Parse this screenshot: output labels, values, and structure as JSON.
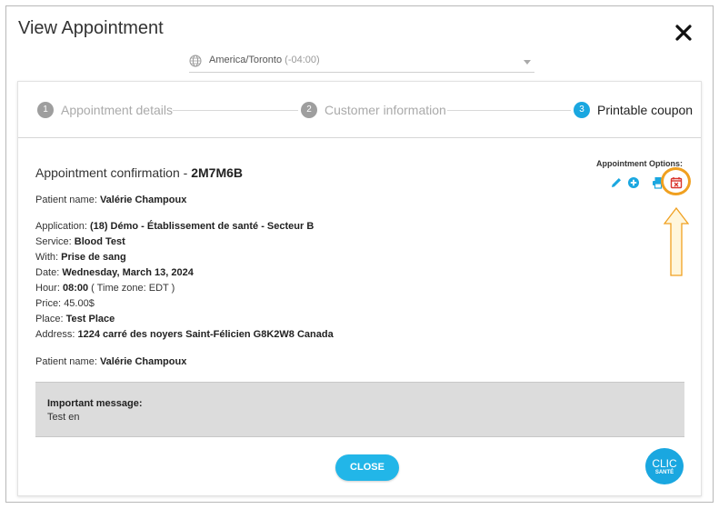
{
  "dialog": {
    "title": "View Appointment",
    "timezone": {
      "name": "America/Toronto",
      "offset": "(-04:00)"
    }
  },
  "steps": [
    {
      "number": "1",
      "label": "Appointment details",
      "active": false
    },
    {
      "number": "2",
      "label": "Customer information",
      "active": false
    },
    {
      "number": "3",
      "label": "Printable coupon",
      "active": true
    }
  ],
  "confirmation": {
    "label": "Appointment confirmation - ",
    "code": "2M7M6B"
  },
  "options": {
    "label": "Appointment Options:",
    "icons": [
      "edit-icon",
      "add-icon",
      "print-icon",
      "cancel-appointment-icon"
    ]
  },
  "details": {
    "patient_label": "Patient name: ",
    "patient_name": "Valérie Champoux",
    "application_label": "Application: ",
    "application_value": "(18) Démo - Établissement de santé - Secteur B",
    "service_label": "Service: ",
    "service_value": "Blood Test",
    "with_label": "With: ",
    "with_value": "Prise de sang",
    "date_label": "Date: ",
    "date_value": "Wednesday, March 13, 2024",
    "hour_label": "Hour: ",
    "hour_value": "08:00",
    "hour_tz": " ( Time zone: EDT )",
    "price_label": "Price: ",
    "price_value": "45.00$",
    "place_label": "Place: ",
    "place_value": "Test Place",
    "address_label": "Address: ",
    "address_value": "1224 carré des noyers Saint-Félicien G8K2W8 Canada",
    "patient2_label": "Patient name: ",
    "patient2_name": "Valérie Champoux"
  },
  "message": {
    "title": "Important message:",
    "body": "Test en"
  },
  "close_button": "CLOSE",
  "logo": {
    "line1": "CLIC",
    "line2": "SANTÉ"
  },
  "colors": {
    "accent": "#1aa7e0",
    "button": "#22b6e8",
    "danger": "#d9342b",
    "highlight": "#f0a020"
  }
}
